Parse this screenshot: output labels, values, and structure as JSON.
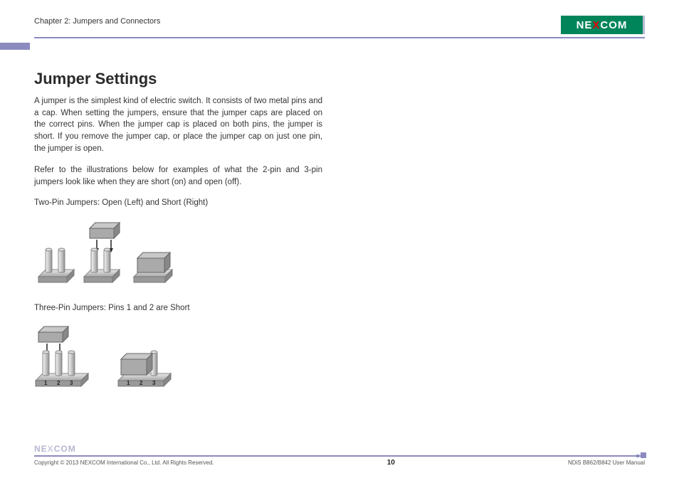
{
  "header": {
    "chapter": "Chapter 2: Jumpers and Connectors",
    "logo_left": "NE",
    "logo_x": "X",
    "logo_right": "COM"
  },
  "main": {
    "heading": "Jumper Settings",
    "para1": "A jumper is the simplest kind of electric switch. It consists of two metal pins and a cap. When setting the jumpers, ensure that the jumper caps are placed on the correct pins. When the jumper cap is placed on both pins, the jumper is short. If you remove the jumper cap, or place the jumper cap on just one pin, the jumper is open.",
    "para2": "Refer to the illustrations below for examples of what the 2-pin and 3-pin jumpers look like when they are short (on) and open (off).",
    "caption1": "Two-Pin Jumpers: Open (Left) and Short (Right)",
    "caption2": "Three-Pin Jumpers: Pins 1 and 2 are Short"
  },
  "footer": {
    "logo_left": "NE",
    "logo_x": "X",
    "logo_right": "COM",
    "copyright": "Copyright © 2013 NEXCOM International Co., Ltd. All Rights Reserved.",
    "page": "10",
    "manual": "NDiS B862/B842 User Manual"
  }
}
